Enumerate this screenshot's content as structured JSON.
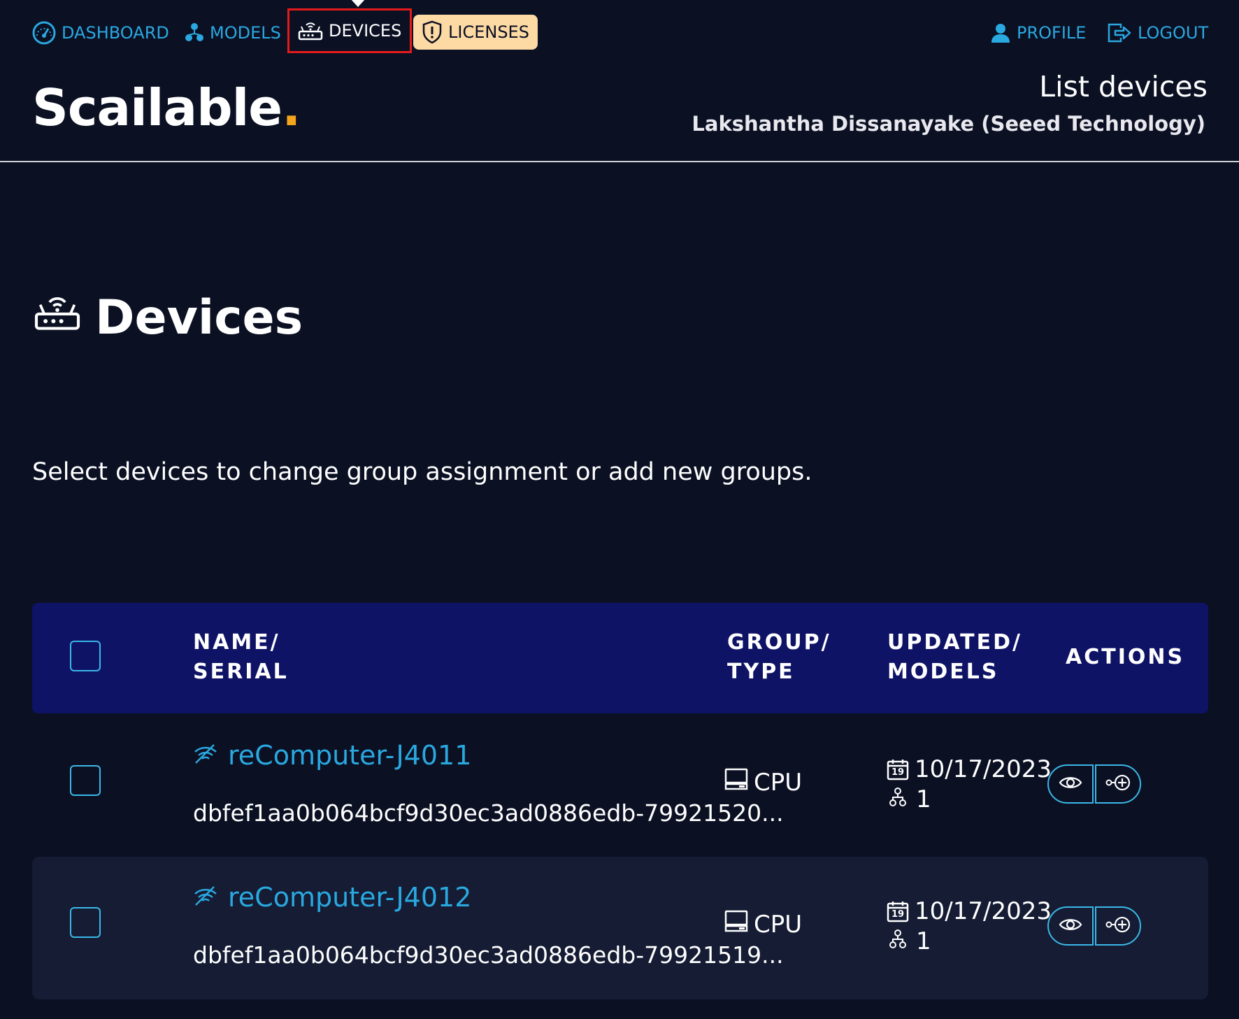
{
  "nav": {
    "dashboard": "DASHBOARD",
    "models": "MODELS",
    "devices": "DEVICES",
    "licenses": "LICENSES",
    "profile": "PROFILE",
    "logout": "LOGOUT"
  },
  "brand": {
    "name": "Scailable",
    "dot": "."
  },
  "header": {
    "page_title": "List devices",
    "user": "Lakshantha Dissanayake  (Seeed Technology)"
  },
  "page": {
    "title": "Devices",
    "instructions": "Select devices to change group assignment or add new groups."
  },
  "table": {
    "columns": {
      "name_line1": "NAME/",
      "name_line2": "SERIAL",
      "group_line1": "GROUP/",
      "group_line2": "TYPE",
      "updated_line1": "UPDATED/",
      "updated_line2": "MODELS",
      "actions": "ACTIONS"
    },
    "rows": [
      {
        "name": "reComputer-J4011",
        "serial": "dbfef1aa0b064bcf9d30ec3ad0886edb-79921520...",
        "type": "CPU",
        "updated": "10/17/2023",
        "models": "1",
        "calendar_day": "19"
      },
      {
        "name": "reComputer-J4012",
        "serial": "dbfef1aa0b064bcf9d30ec3ad0886edb-79921519...",
        "type": "CPU",
        "updated": "10/17/2023",
        "models": "1",
        "calendar_day": "19"
      }
    ]
  },
  "colors": {
    "background": "#0b1023",
    "accent": "#2aa8e0",
    "header_band": "#0e1366",
    "license_badge": "#fdd9a4",
    "highlight_box": "#e31b1b",
    "brand_dot": "#f4a51c"
  },
  "icons": {
    "dashboard": "speedometer-icon",
    "models": "model-tree-icon",
    "devices": "router-icon",
    "licenses": "shield-icon",
    "profile": "user-icon",
    "logout": "logout-icon",
    "offline": "wifi-off-icon",
    "type": "computer-icon",
    "calendar": "calendar-icon",
    "view": "eye-icon",
    "assign": "add-model-icon"
  }
}
